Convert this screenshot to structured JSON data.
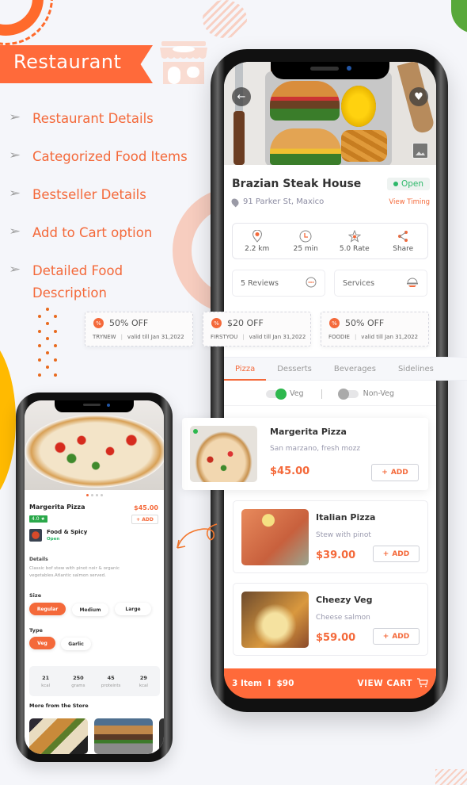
{
  "promo": {
    "title": "Restaurant",
    "features": [
      "Restaurant Details",
      "Categorized Food Items",
      "Bestseller Details",
      "Add to Cart option",
      "Detailed Food Description"
    ]
  },
  "main_phone": {
    "restaurant_name": "Brazian Steak House",
    "status": "Open",
    "address": "91 Parker St, Maxico",
    "view_timing": "View Timing",
    "stats": [
      {
        "icon": "location-pin-icon",
        "label": "2.2 km"
      },
      {
        "icon": "clock-icon",
        "label": "25 min"
      },
      {
        "icon": "star-icon",
        "label": "5.0 Rate"
      },
      {
        "icon": "share-icon",
        "label": "Share"
      }
    ],
    "reviews_label": "5 Reviews",
    "services_label": "Services",
    "tabs": [
      "Pizza",
      "Desserts",
      "Beverages",
      "Sidelines"
    ],
    "active_tab": "Pizza",
    "filters": {
      "veg": "Veg",
      "non_veg": "Non-Veg",
      "veg_on": true,
      "non_veg_on": false
    },
    "items": [
      {
        "name": "Margerita Pizza",
        "desc": "San marzano, fresh mozz",
        "price": "$45.00",
        "add": "ADD",
        "veg": true
      },
      {
        "name": "Italian Pizza",
        "desc": "Stew with pinot",
        "price": "$39.00",
        "add": "ADD"
      },
      {
        "name": "Cheezy Veg",
        "desc": "Cheese salmon",
        "price": "$59.00",
        "add": "ADD"
      }
    ],
    "cart": {
      "summary": "3 Item  I  $90",
      "action": "VIEW CART"
    }
  },
  "coupons": [
    {
      "title": "50% OFF",
      "code": "TRYNEW",
      "validity": "valid till Jan 31,2022"
    },
    {
      "title": "$20 OFF",
      "code": "FIRSTYOU",
      "validity": "valid till Jan 31,2022"
    },
    {
      "title": "50% OFF",
      "code": "FOODIE",
      "validity": "valid till Jan 31,2022"
    }
  ],
  "detail_phone": {
    "item_name": "Margerita Pizza",
    "price": "$45.00",
    "rating": "4.0 ★",
    "add": "+ ADD",
    "store_name": "Food & Spicy",
    "store_status": "Open",
    "details_heading": "Details",
    "details_text": "Classic bof stew with pinot noir & organic vegetables.Atlantic salmon served.",
    "size_heading": "Size",
    "sizes": [
      "Regular",
      "Medium",
      "Large"
    ],
    "selected_size": "Regular",
    "type_heading": "Type",
    "types": [
      "Veg",
      "Garlic"
    ],
    "selected_type": "Veg",
    "nutrition": [
      {
        "value": "21",
        "unit": "kcal"
      },
      {
        "value": "250",
        "unit": "grams"
      },
      {
        "value": "45",
        "unit": "proteints"
      },
      {
        "value": "29",
        "unit": "kcal"
      }
    ],
    "more_heading": "More from the Store",
    "carousel_index": 1,
    "carousel_total": 4
  },
  "colors": {
    "accent": "#ff6a3a",
    "success": "#2eb86a",
    "background": "#f5f6fa"
  }
}
